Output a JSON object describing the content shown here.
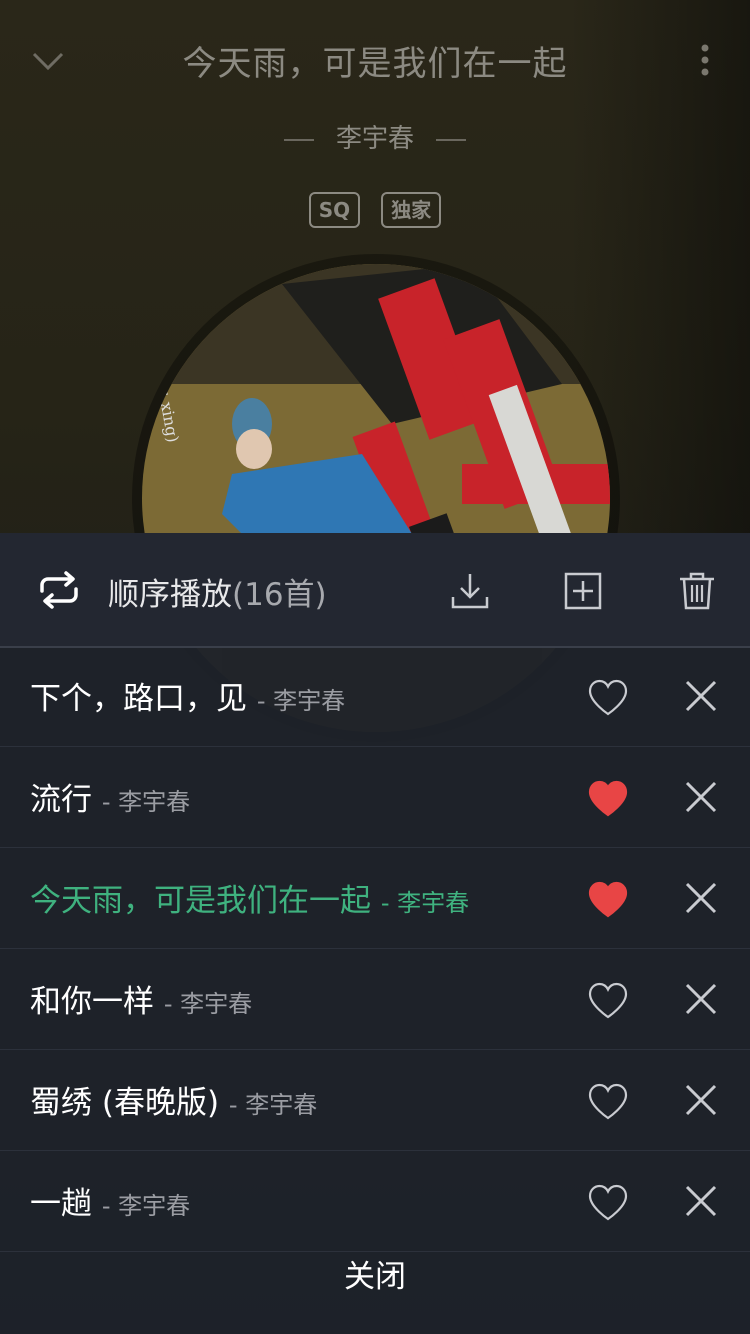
{
  "player": {
    "title": "今天雨，可是我们在一起",
    "artist": "李宇春",
    "badges": [
      "SQ",
      "独家"
    ],
    "cover_caption": "(liu xing)"
  },
  "playlist": {
    "mode_label": "顺序播放",
    "count_label": "(16首)",
    "close_label": "关闭",
    "songs": [
      {
        "title": "下个，路口，见",
        "artist": "- 李宇春",
        "liked": false,
        "playing": false
      },
      {
        "title": "流行",
        "artist": "- 李宇春",
        "liked": true,
        "playing": false
      },
      {
        "title": "今天雨，可是我们在一起",
        "artist": "- 李宇春",
        "liked": true,
        "playing": true
      },
      {
        "title": "和你一样",
        "artist": "- 李宇春",
        "liked": false,
        "playing": false
      },
      {
        "title": "蜀绣 (春晚版)",
        "artist": "- 李宇春",
        "liked": false,
        "playing": false
      },
      {
        "title": "一趟",
        "artist": "- 李宇春",
        "liked": false,
        "playing": false
      }
    ]
  },
  "colors": {
    "accent": "#3fb27f",
    "liked_heart": "#e84545",
    "panel_bg": "#1e222a"
  },
  "icons": {
    "back": "chevron-down-icon",
    "more": "more-vertical-icon",
    "mode": "repeat-icon",
    "download": "download-icon",
    "add": "add-to-playlist-icon",
    "delete": "trash-icon",
    "like": "heart-icon",
    "remove": "close-icon"
  }
}
